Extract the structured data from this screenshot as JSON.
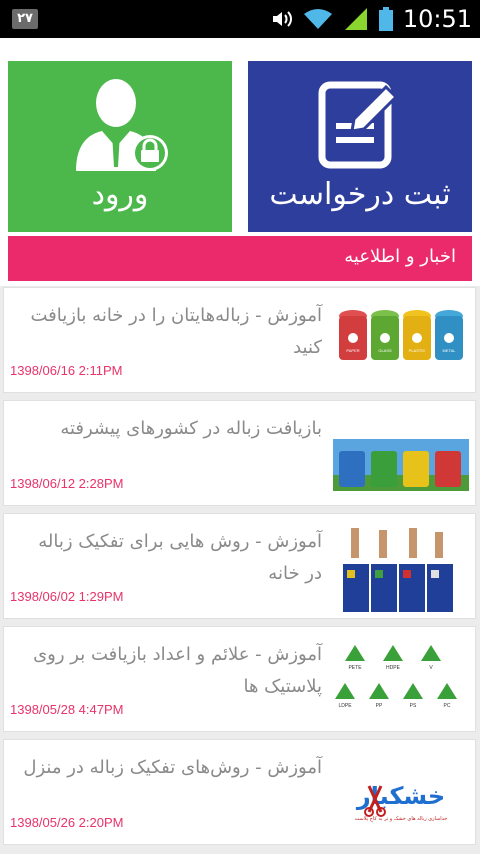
{
  "status_bar": {
    "notification": "۲۷",
    "time": "10:51"
  },
  "tiles": {
    "login_label": "ورود",
    "request_label": "ثبت درخواست",
    "login_color": "#4cb84c",
    "request_color": "#2e3e9c"
  },
  "news_header": {
    "label": "اخبار و اطلاعیه",
    "color": "#eb2a6b"
  },
  "news": [
    {
      "title": "آموزش - زباله‌هایتان را در خانه بازیافت کنید",
      "date": "1398/06/16 2:11PM"
    },
    {
      "title": "بازیافت زباله در کشورهای پیشرفته",
      "date": "1398/06/12 2:28PM"
    },
    {
      "title": "آموزش - روش هایی برای تفکیک زباله در خانه",
      "date": "1398/06/02 1:29PM"
    },
    {
      "title": "آموزش - علائم و اعداد بازیافت بر روی پلاستیک ها",
      "date": "1398/05/28 4:47PM"
    },
    {
      "title": "آموزش - روش‌های تفکیک زباله در منزل",
      "date": "1398/05/26 2:20PM"
    }
  ],
  "thumbs": {
    "bin_labels": [
      "PAPER",
      "GLASS",
      "PLASTIC",
      "METAL"
    ],
    "recycle_codes": [
      "PETE",
      "HDPE",
      "V",
      "LDPE",
      "PP",
      "PS",
      "PC"
    ],
    "brand_logo": "خشکبار",
    "brand_tagline": "جداسازی زباله های خشک و تر به کاج پلاست"
  }
}
